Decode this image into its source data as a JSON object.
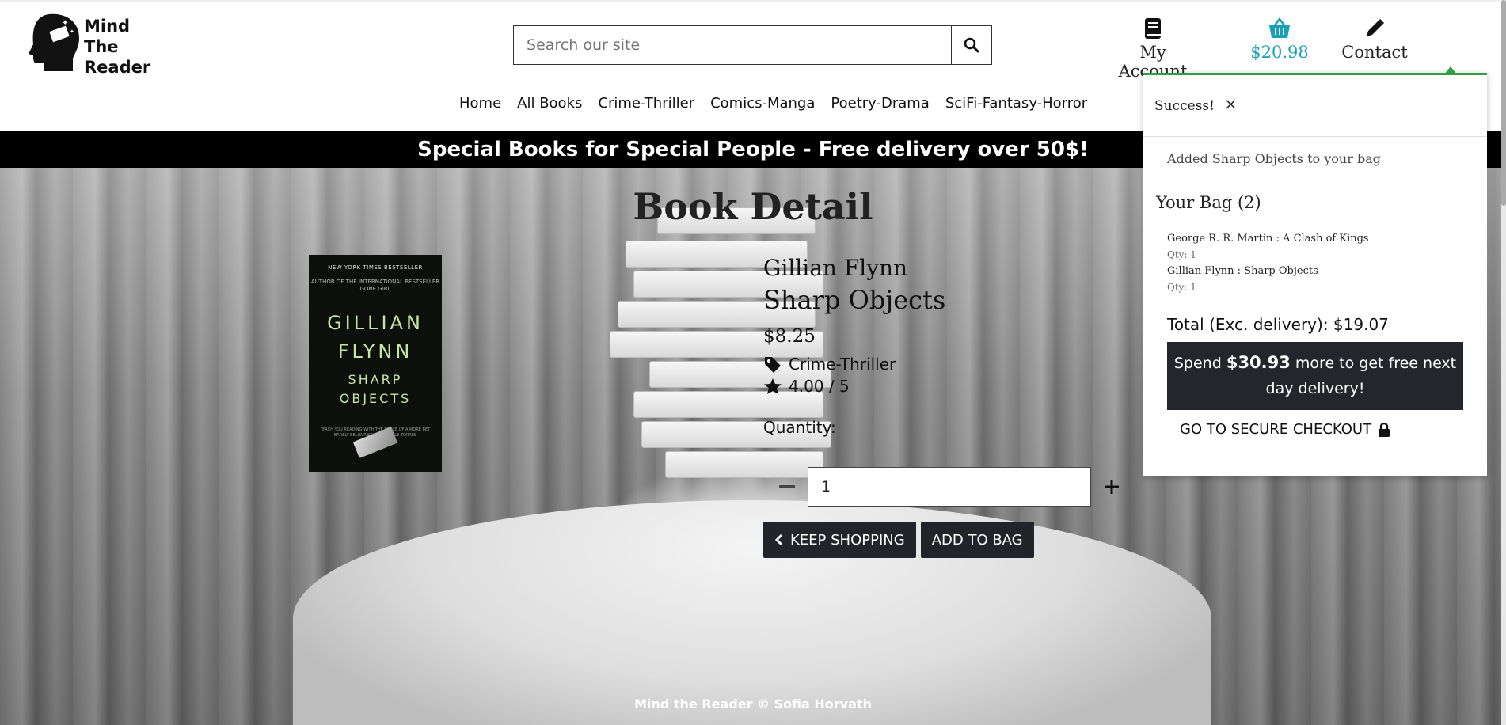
{
  "logo": {
    "lines": [
      "Mind",
      "The",
      "Reader"
    ]
  },
  "search": {
    "placeholder": "Search our site"
  },
  "header_nav": {
    "account_label": "My Account",
    "bag_total": "$20.98",
    "contact_label": "Contact"
  },
  "main_nav": [
    "Home",
    "All Books",
    "Crime-Thriller",
    "Comics-Manga",
    "Poetry-Drama",
    "SciFi-Fantasy-Horror"
  ],
  "banner": "Special Books for Special People - Free delivery over 50$!",
  "page": {
    "title": "Book Detail"
  },
  "cover": {
    "bestseller": "NEW YORK TIMES BESTSELLER",
    "author_of": "AUTHOR OF THE INTERNATIONAL BESTSELLER GONE GIRL",
    "author_line1": "GILLIAN",
    "author_line2": "FLYNN",
    "title_line1": "SHARP",
    "title_line2": "OBJECTS",
    "quote": "\"EACH YOU READING WITH THE FORCE OF A MORE BET BARELY BELIEVABLE\" - MICHELLE TORRES"
  },
  "book": {
    "author": "Gillian Flynn",
    "title": "Sharp Objects",
    "price": "$8.25",
    "category": "Crime-Thriller",
    "rating": "4.00 / 5",
    "quantity_label": "Quantity:",
    "quantity_value": "1"
  },
  "buttons": {
    "keep_shopping": "KEEP SHOPPING",
    "add_to_bag": "ADD TO BAG"
  },
  "footer": "Mind the Reader © Sofia Horvath",
  "toast": {
    "header": "Success!",
    "message": "Added Sharp Objects to your bag",
    "bag_title": "Your Bag (2)",
    "items": [
      {
        "name": "George R. R. Martin : A Clash of Kings",
        "qty": "Qty: 1"
      },
      {
        "name": "Gillian Flynn : Sharp Objects",
        "qty": "Qty: 1"
      }
    ],
    "total": "Total (Exc. delivery): $19.07",
    "promo_before": "Spend ",
    "promo_amount": "$30.93",
    "promo_after": " more to get free next day delivery!",
    "checkout": "GO TO SECURE CHECKOUT"
  },
  "colors": {
    "accent": "#17a2b8",
    "success": "#2e9e47",
    "dark": "#212529"
  },
  "icons": [
    "search-icon",
    "book-icon",
    "basket-icon",
    "pencil-icon",
    "tag-icon",
    "star-icon",
    "minus-icon",
    "plus-icon",
    "chevron-left-icon",
    "close-icon",
    "lock-icon"
  ]
}
